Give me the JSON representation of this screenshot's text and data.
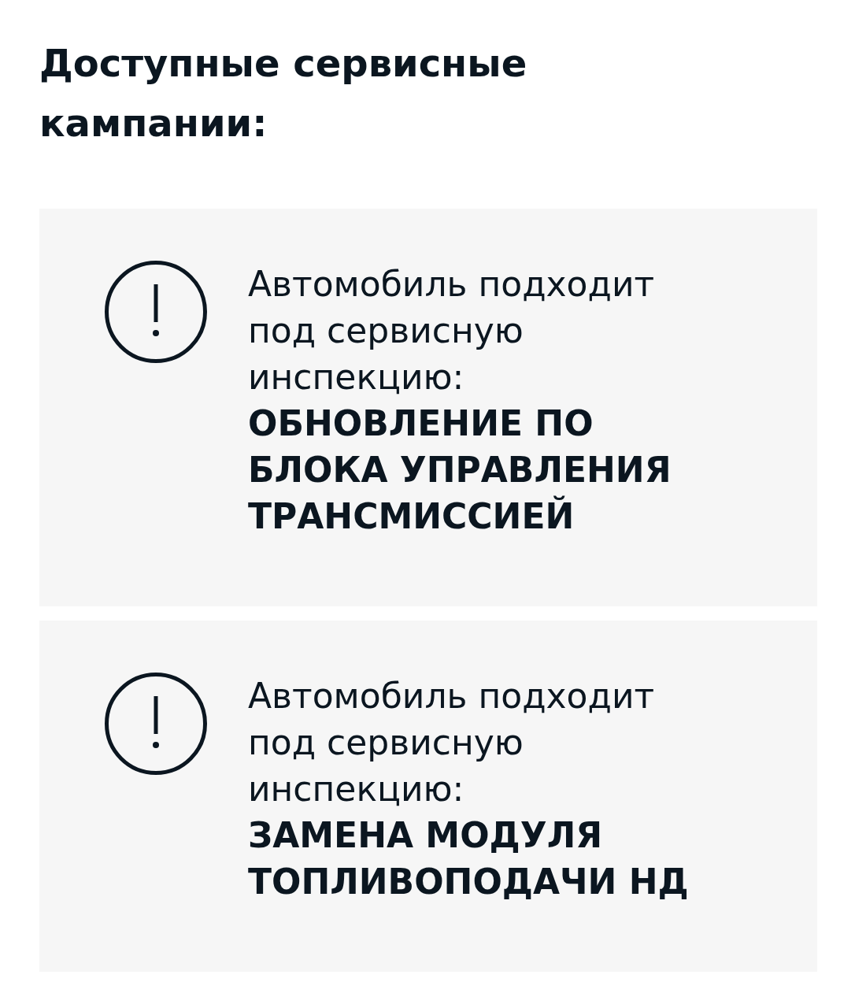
{
  "heading": "Доступные сервисные кампании:",
  "campaigns": [
    {
      "intro": "Автомобиль подходит под сервисную инспекцию:",
      "name": "ОБНОВЛЕНИЕ ПО БЛОКА УПРАВЛЕНИЯ ТРАНСМИССИЕЙ"
    },
    {
      "intro": "Автомобиль подходит под сервисную инспекцию:",
      "name": "ЗАМЕНА МОДУЛЯ ТОПЛИВОПОДАЧИ НД"
    }
  ]
}
